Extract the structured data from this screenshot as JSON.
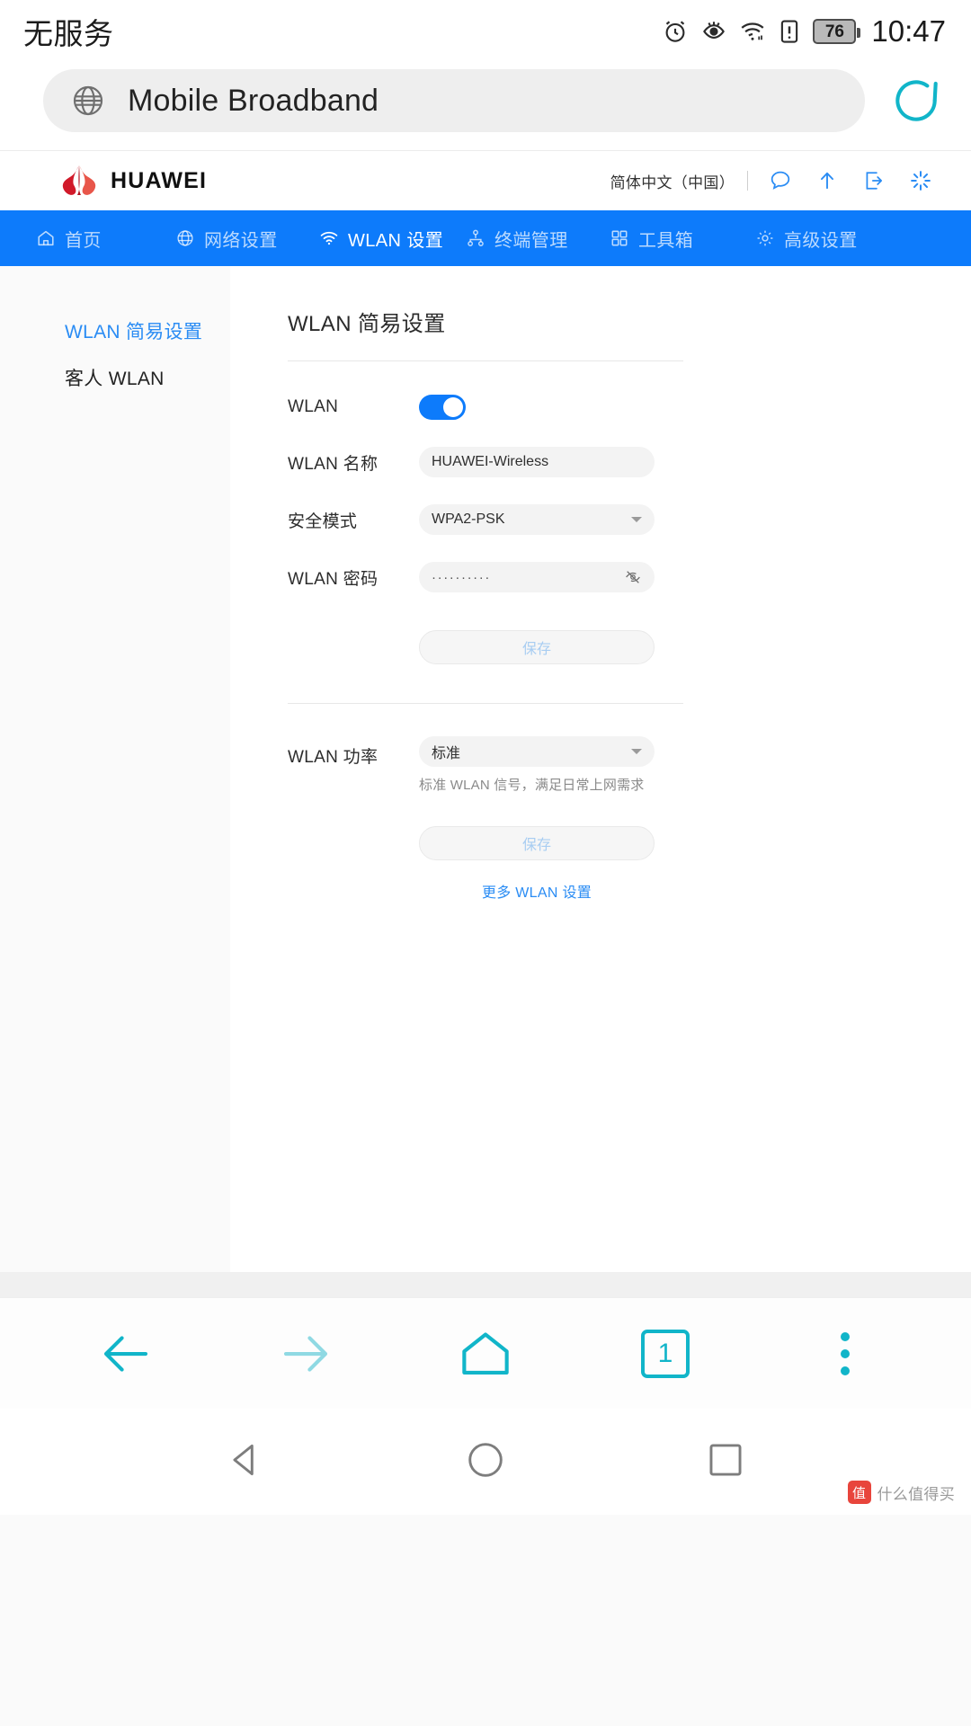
{
  "status_bar": {
    "carrier": "无服务",
    "time": "10:47",
    "battery_percent": "76",
    "icons": [
      "alarm-icon",
      "eye-icon",
      "wifi-icon",
      "sim-alert-icon",
      "battery-icon"
    ]
  },
  "browser": {
    "url_title": "Mobile Broadband",
    "globe_icon": "globe-icon",
    "reload_icon": "reload-icon",
    "toolbar": {
      "back": "back-arrow-icon",
      "forward": "forward-arrow-icon",
      "home": "home-icon",
      "tab_count": "1",
      "menu": "more-vertical-icon"
    }
  },
  "router_header": {
    "brand": "HUAWEI",
    "language": "简体中文（中国）",
    "icons": [
      "chat-icon",
      "upload-arrow-icon",
      "logout-icon",
      "loading-icon"
    ]
  },
  "nav": {
    "items": [
      {
        "label": "首页",
        "icon": "home-icon",
        "active": false
      },
      {
        "label": "网络设置",
        "icon": "globe-icon",
        "active": false
      },
      {
        "label": "WLAN 设置",
        "icon": "wifi-icon",
        "active": true
      },
      {
        "label": "终端管理",
        "icon": "devices-icon",
        "active": false
      },
      {
        "label": "工具箱",
        "icon": "grid-icon",
        "active": false
      },
      {
        "label": "高级设置",
        "icon": "gear-icon",
        "active": false
      }
    ]
  },
  "sidebar": {
    "items": [
      {
        "label": "WLAN 简易设置",
        "active": true
      },
      {
        "label": "客人 WLAN",
        "active": false
      }
    ]
  },
  "main": {
    "title": "WLAN 简易设置",
    "wlan_toggle": {
      "label": "WLAN",
      "on": true
    },
    "wlan_name": {
      "label": "WLAN 名称",
      "value": "HUAWEI-Wireless"
    },
    "security_mode": {
      "label": "安全模式",
      "value": "WPA2-PSK"
    },
    "wlan_password": {
      "label": "WLAN 密码",
      "value": "··········",
      "eye_icon": "eye-off-icon"
    },
    "save_button_1": "保存",
    "wlan_power": {
      "label": "WLAN 功率",
      "value": "标准"
    },
    "power_hint": "标准 WLAN 信号，满足日常上网需求",
    "save_button_2": "保存",
    "more_link": "更多 WLAN 设置"
  },
  "android_nav": {
    "back": "triangle-back-icon",
    "home": "circle-home-icon",
    "recents": "square-recents-icon"
  },
  "watermark": {
    "badge": "值",
    "text": "什么值得买"
  },
  "colors": {
    "nav_blue": "#0d7bfb",
    "accent_teal": "#11b5c9",
    "link_blue": "#2a8cf4",
    "huawei_red": "#cf0a2c"
  }
}
